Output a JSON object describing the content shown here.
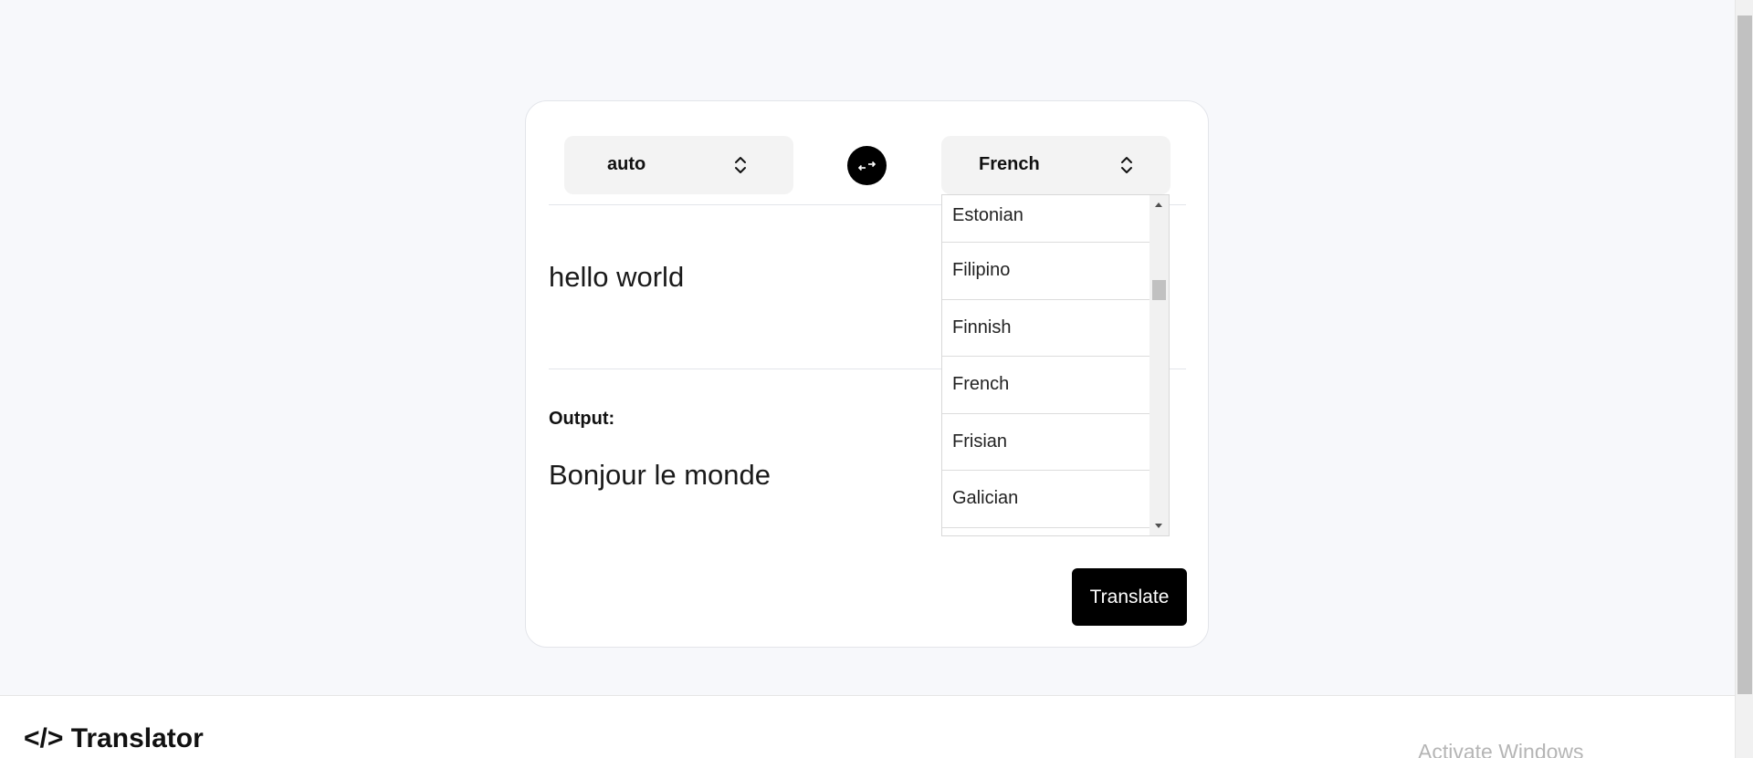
{
  "translator": {
    "source_language": "auto",
    "target_language": "French",
    "input_text": "hello world",
    "output_label": "Output:",
    "output_text": "Bonjour le monde",
    "translate_button": "Translate",
    "swap_icon": "swap-arrows-icon",
    "select_icon": "chevron-up-down-icon"
  },
  "dropdown": {
    "options": [
      "Estonian",
      "Filipino",
      "Finnish",
      "French",
      "Frisian",
      "Galician"
    ],
    "selected": "French"
  },
  "footer": {
    "brand": "</> Translator",
    "watermark": "Activate Windows"
  },
  "colors": {
    "background": "#f7f8fb",
    "card": "#ffffff",
    "accent": "#000000",
    "select_bg": "#f3f3f3"
  }
}
